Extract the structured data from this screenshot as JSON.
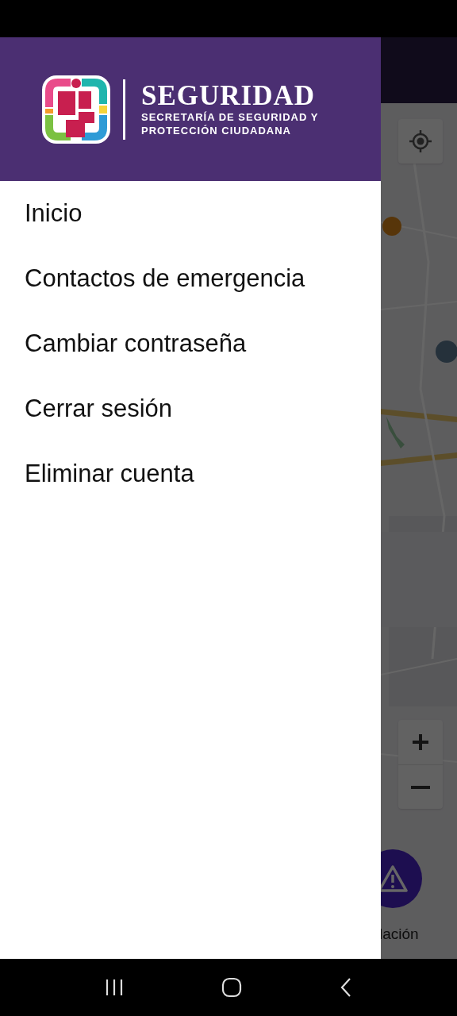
{
  "drawer": {
    "header": {
      "title": "SEGURIDAD",
      "subtitle_lines": [
        "SECRETARÍA DE SEGURIDAD Y",
        "PROTECCIÓN CIUDADANA"
      ]
    },
    "items": [
      {
        "label": "Inicio"
      },
      {
        "label": "Contactos de emergencia"
      },
      {
        "label": "Cambiar contraseña"
      },
      {
        "label": "Cerrar sesión"
      },
      {
        "label": "Eliminar cuenta"
      }
    ]
  },
  "map_screen": {
    "fab_label": "lación"
  }
}
